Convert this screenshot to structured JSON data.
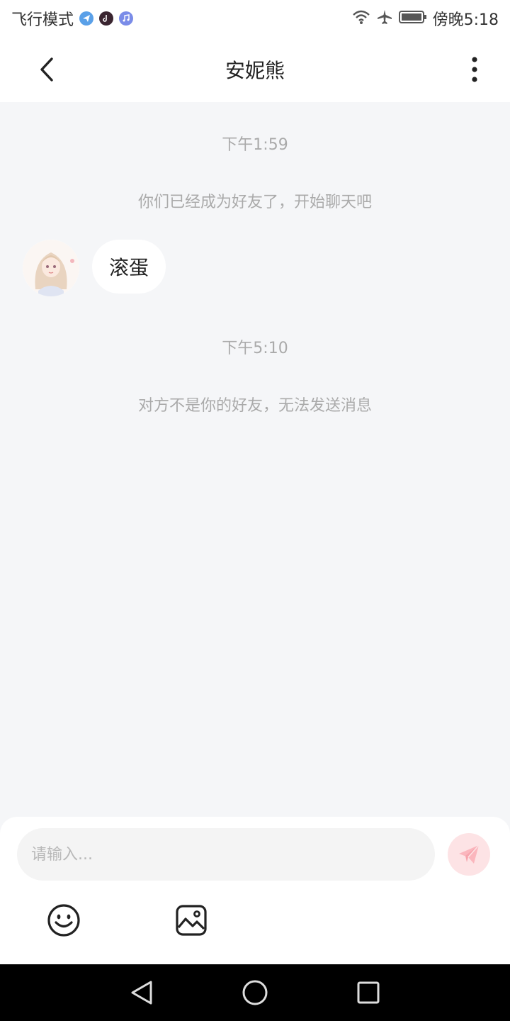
{
  "status_bar": {
    "left_text": "飞行模式",
    "right_time": "傍晚5:18",
    "icons": [
      "telegram-icon",
      "tiktok-icon",
      "music-icon",
      "wifi-icon",
      "airplane-icon",
      "battery-icon"
    ]
  },
  "header": {
    "title": "安妮熊",
    "back_icon": "chevron-left-icon",
    "more_icon": "more-vertical-icon"
  },
  "chat": {
    "time_1": "下午1:59",
    "system_1": "你们已经成为好友了，开始聊天吧",
    "message_1": {
      "text": "滚蛋",
      "avatar": "anime-girl-avatar"
    },
    "time_2": "下午5:10",
    "system_2": "对方不是你的好友，无法发送消息"
  },
  "composer": {
    "placeholder": "请输入...",
    "value": "",
    "send_icon": "paper-plane-icon",
    "tools": [
      "emoji-icon",
      "image-icon"
    ]
  },
  "colors": {
    "send_bg": "#fde3e5",
    "send_fg": "#fbb6bd",
    "chat_bg": "#f5f6f8",
    "hint_text": "#aaaaaa"
  }
}
